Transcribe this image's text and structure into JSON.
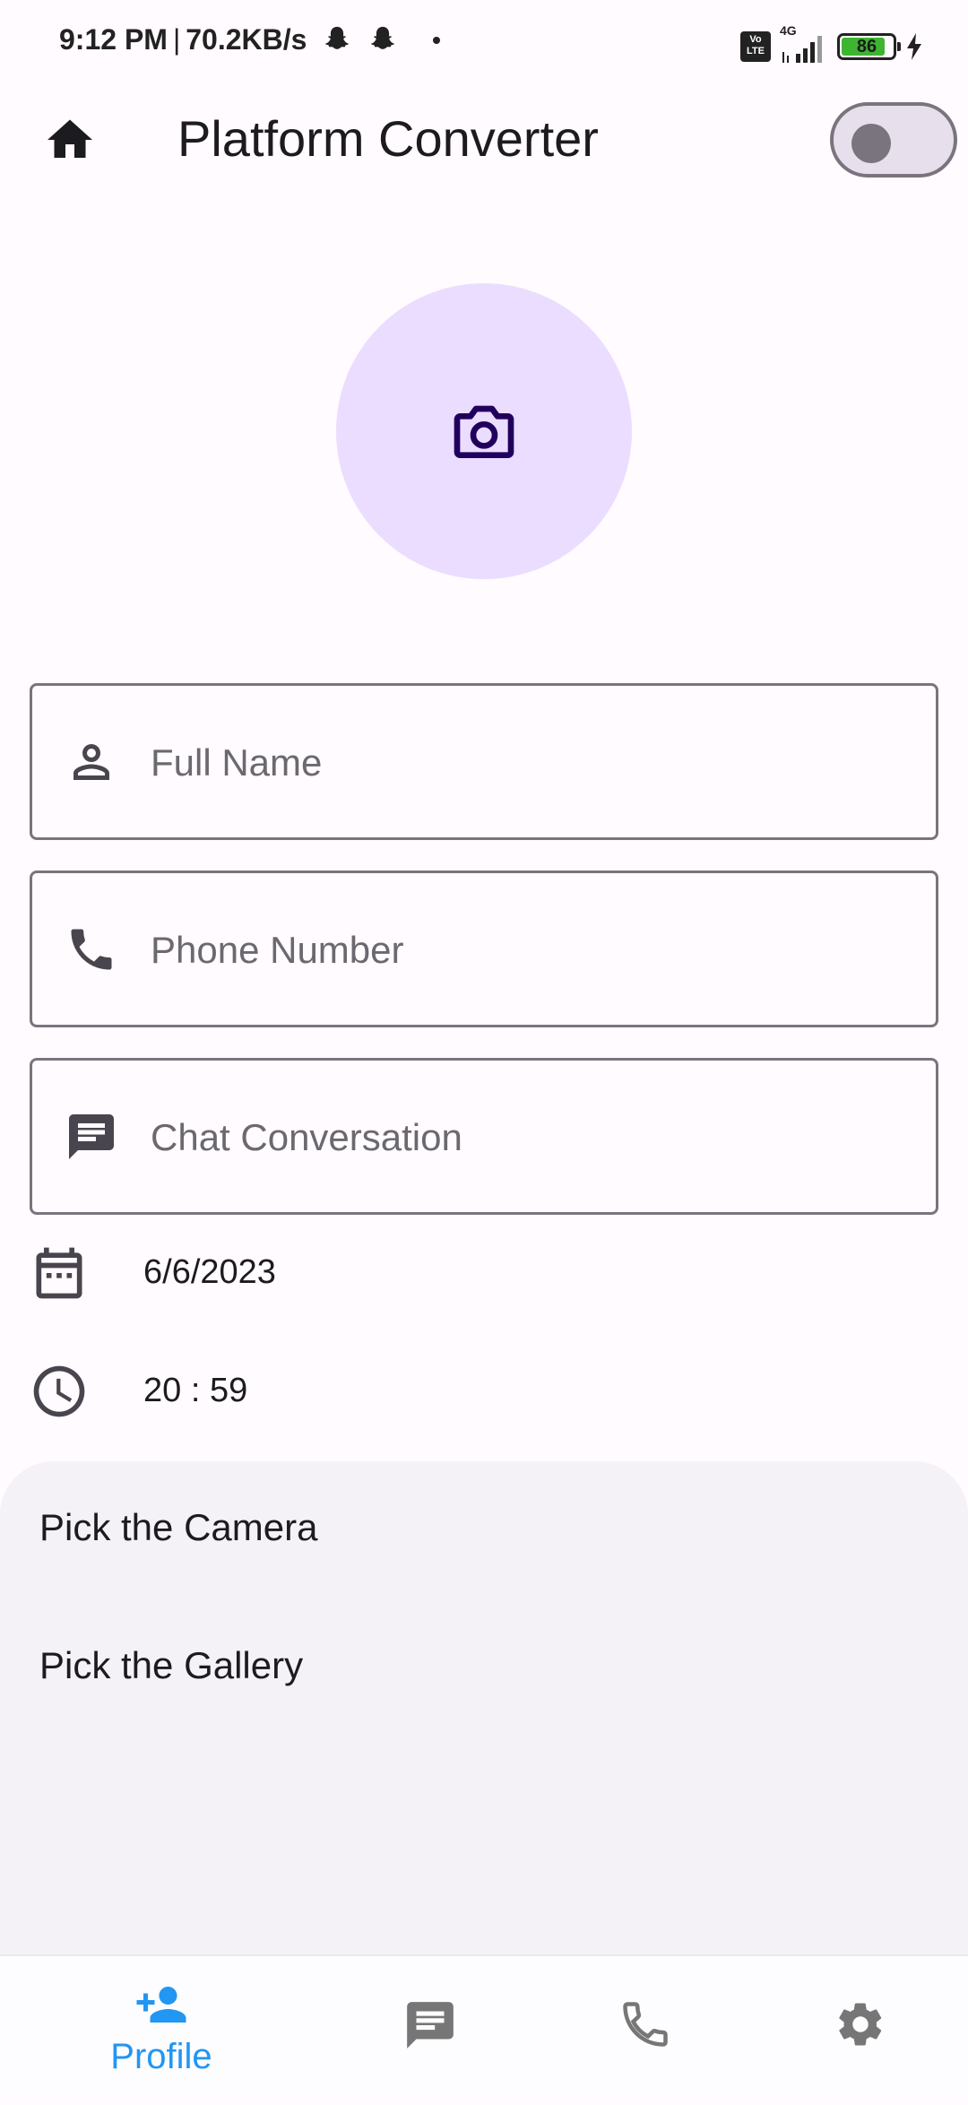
{
  "status_bar": {
    "time": "9:12 PM",
    "net_speed": "70.2KB/s",
    "network": "4G",
    "volte": "Vo LTE",
    "battery": "86"
  },
  "app_bar": {
    "title": "Platform Converter",
    "home_icon": "home-icon",
    "toggle_on": false
  },
  "avatar": {
    "icon": "camera-icon"
  },
  "form": {
    "full_name": {
      "placeholder": "Full Name",
      "value": "",
      "icon": "person-icon"
    },
    "phone": {
      "placeholder": "Phone Number",
      "value": "",
      "icon": "phone-icon"
    },
    "chat": {
      "placeholder": "Chat Conversation",
      "value": "",
      "icon": "chat-icon"
    },
    "date": {
      "value": "6/6/2023",
      "icon": "calendar-icon"
    },
    "time": {
      "value": "20 : 59",
      "icon": "clock-icon"
    }
  },
  "sheet": {
    "items": [
      "Pick the Camera",
      "Pick the Gallery"
    ]
  },
  "bottom_nav": {
    "items": [
      {
        "label": "Profile",
        "icon": "person-add-icon",
        "active": true
      },
      {
        "label": "",
        "icon": "chat-icon",
        "active": false
      },
      {
        "label": "",
        "icon": "phone-icon",
        "active": false
      },
      {
        "label": "",
        "icon": "gear-icon",
        "active": false
      }
    ],
    "active_color": "#2196F3",
    "inactive_color": "#767676"
  },
  "colors": {
    "background": "#FFFBFE",
    "avatar_bg": "#EADDFF",
    "field_border": "#79747E",
    "sheet_bg": "#F4F1F7"
  }
}
